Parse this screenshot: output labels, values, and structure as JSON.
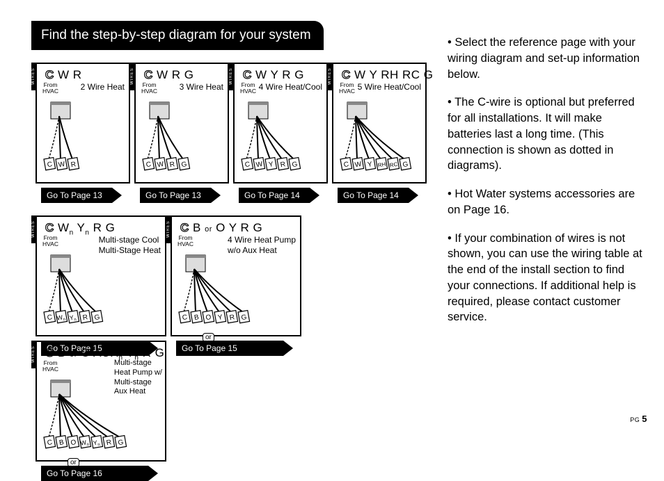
{
  "title": "Find the step-by-step diagram for your system",
  "sideLabel": "WIRES",
  "from": "From\nHVAC",
  "cards": [
    {
      "terms": "C W R",
      "desc": "2 Wire Heat",
      "goto": "Go To Page 13",
      "termLabels": [
        "C",
        "W",
        "R"
      ]
    },
    {
      "terms": "C W R G",
      "desc": "3 Wire Heat",
      "goto": "Go To Page 13",
      "termLabels": [
        "C",
        "W",
        "R",
        "G"
      ]
    },
    {
      "terms": "C W Y R G",
      "desc": "4 Wire Heat/Cool",
      "goto": "Go To Page 14",
      "termLabels": [
        "C",
        "W",
        "Y",
        "R",
        "G"
      ]
    },
    {
      "terms": "C W Y RH RC G",
      "desc": "5 Wire Heat/Cool",
      "goto": "Go To Page 14",
      "termLabels": [
        "C",
        "W",
        "Y",
        "RH",
        "RC",
        "G"
      ]
    },
    {
      "terms": "C Wn Yn R   G",
      "desc": "Multi-stage Cool\nMulti-Stage Heat",
      "goto": "Go To Page 15",
      "termLabels": [
        "C",
        "Wn",
        "Yn",
        "R",
        "G"
      ]
    },
    {
      "terms": "C B or O  Y R G",
      "desc": "4 Wire Heat Pump\nw/o Aux Heat",
      "goto": "Go To Page 15",
      "termLabels": [
        "C",
        "B",
        "O",
        "Y",
        "R",
        "G"
      ],
      "or": true
    },
    {
      "terms": "C B or O AUXn Yn R G",
      "desc": "Multi-stage\nHeat Pump w/\nMulti-stage\nAux Heat",
      "goto": "Go To Page 16",
      "termLabels": [
        "C",
        "B",
        "O",
        "Wn",
        "Yn",
        "R",
        "G"
      ],
      "or": true
    }
  ],
  "bullets": [
    "• Select the reference page with your wiring diagram and set-up information below.",
    "• The C-wire is optional but preferred for all installations. It will make batteries last a long time.  (This connection is shown as dotted in diagrams).",
    "• Hot Water systems accessories are on Page 16.",
    "• If your combination of wires is not shown, you can use the wiring table at the end of the install section to find your connections. If additional help is required, please contact customer service."
  ],
  "pageLabel": "PG",
  "pageNum": "5"
}
